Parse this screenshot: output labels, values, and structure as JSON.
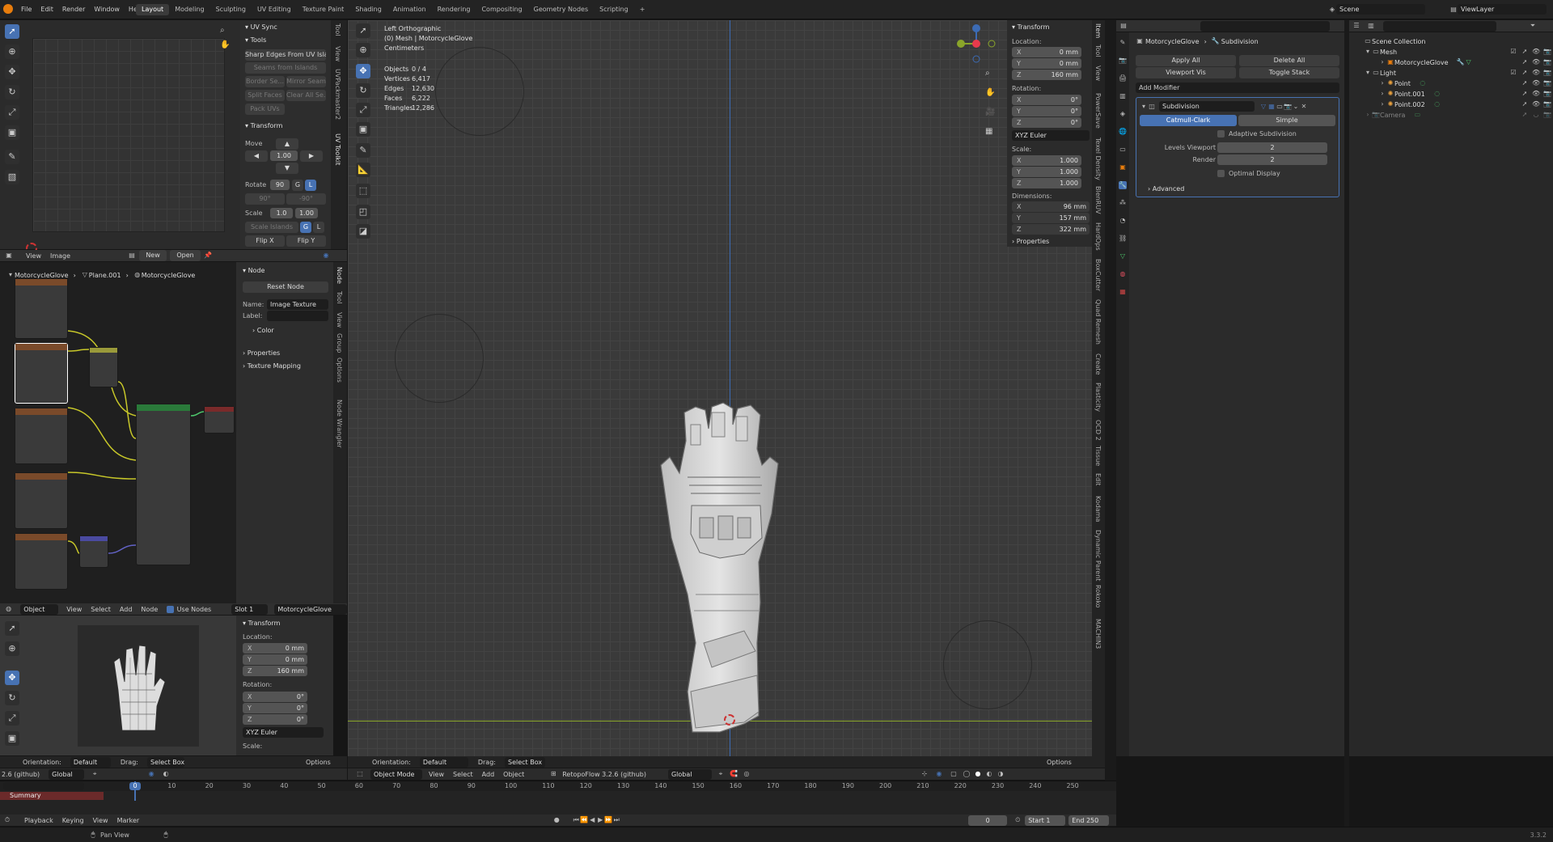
{
  "topbar": {
    "menus": [
      "File",
      "Edit",
      "Render",
      "Window",
      "Help"
    ],
    "workspaces": [
      "Layout",
      "Modeling",
      "Sculpting",
      "UV Editing",
      "Texture Paint",
      "Shading",
      "Animation",
      "Rendering",
      "Compositing",
      "Geometry Nodes",
      "Scripting"
    ],
    "add_tab": "+",
    "scene": "Scene",
    "view_layer": "ViewLayer"
  },
  "uv_panel": {
    "uv_sync": "UV Sync",
    "tools": "Tools",
    "sharp_edges": "Sharp Edges From UV Islands",
    "seams_from_islands": "Seams from Islands",
    "border_se": "Border Se...",
    "mirror_seam": "Mirror Seam",
    "split_faces": "Split Faces",
    "clear_all_se": "Clear All Se...",
    "pack_uvs": "Pack UVs",
    "transform": "Transform",
    "move": "Move",
    "move_value": "1.00",
    "rotate": "Rotate",
    "rotate_value": "90",
    "g": "G",
    "l": "L",
    "deg90a": "90°",
    "deg90b": "-90°",
    "scale": "Scale",
    "scale_a": "1.0",
    "scale_b": "1.00",
    "scale_islands": "Scale Islands",
    "flip_x": "Flip X",
    "flip_y": "Flip Y",
    "tabs": [
      "Tool",
      "View",
      "UVPackmaster2",
      "UV Toolkit"
    ]
  },
  "image_header": {
    "view": "View",
    "image": "Image",
    "new": "New",
    "open": "Open"
  },
  "node_editor": {
    "breadcrumb": [
      "MotorcycleGlove",
      "Plane.001",
      "MotorcycleGlove"
    ],
    "side_title": "Node",
    "reset_node": "Reset Node",
    "name_label": "Name:",
    "name_value": "Image Texture",
    "label_label": "Label:",
    "color": "Color",
    "properties": "Properties",
    "texture_mapping": "Texture Mapping",
    "tabs": [
      "Node",
      "Tool",
      "View",
      "Group",
      "Options",
      "Node Wrangler"
    ],
    "footer": {
      "object": "Object",
      "view": "View",
      "select": "Select",
      "add": "Add",
      "node": "Node",
      "use_nodes": "Use Nodes",
      "slot": "Slot 1",
      "material": "MotorcycleGlove"
    }
  },
  "preview_panel": {
    "transform": "Transform",
    "location": "Location:",
    "x": "X",
    "y": "Y",
    "z": "Z",
    "loc_x": "0 mm",
    "loc_y": "0 mm",
    "loc_z": "160 mm",
    "rotation": "Rotation:",
    "rot_x": "0°",
    "rot_y": "0°",
    "rot_z": "0°",
    "euler": "XYZ Euler",
    "scale": "Scale:"
  },
  "left_footer": {
    "orientation": "Orientation:",
    "default": "Default",
    "drag": "Drag:",
    "select_box": "Select Box",
    "options": "Options",
    "version": "2.6 (github)",
    "global": "Global"
  },
  "viewport": {
    "view_name": "Left Orthographic",
    "collection": "(0) Mesh | MotorcycleGlove",
    "units": "Centimeters",
    "stats": [
      {
        "label": "Objects",
        "value": "0 / 4"
      },
      {
        "label": "Vertices",
        "value": "6,417"
      },
      {
        "label": "Edges",
        "value": "12,630"
      },
      {
        "label": "Faces",
        "value": "6,222"
      },
      {
        "label": "Triangles",
        "value": "12,286"
      }
    ],
    "header": {
      "object_mode": "Object Mode",
      "view": "View",
      "select": "Select",
      "add": "Add",
      "object": "Object",
      "retopoflow": "RetopoFlow 3.2.6 (github)",
      "global": "Global"
    },
    "footer": {
      "orientation": "Orientation:",
      "default": "Default",
      "drag": "Drag:",
      "select_box": "Select Box",
      "options": "Options"
    },
    "tabs": [
      "Item",
      "Tool",
      "View",
      "PowerSave",
      "Texel Density",
      "BlenRUV",
      "HardOps",
      "BoxCutter",
      "Quad Remesh",
      "Create",
      "Plasticity",
      "OCD 2",
      "Tissue",
      "Edit",
      "Kodama",
      "Dynamic Parent",
      "Rokoko",
      "MACHIN3"
    ]
  },
  "n_panel": {
    "transform": "Transform",
    "location": "Location:",
    "loc": [
      "0 mm",
      "0 mm",
      "160 mm"
    ],
    "rotation": "Rotation:",
    "rot": [
      "0°",
      "0°",
      "0°"
    ],
    "euler": "XYZ Euler",
    "scale": "Scale:",
    "scl": [
      "1.000",
      "1.000",
      "1.000"
    ],
    "dimensions": "Dimensions:",
    "dim": [
      "96 mm",
      "157 mm",
      "322 mm"
    ],
    "axes": [
      "X",
      "Y",
      "Z"
    ],
    "properties": "Properties"
  },
  "properties": {
    "breadcrumb_obj": "MotorcycleGlove",
    "breadcrumb_mod": "Subdivision",
    "apply_all": "Apply All",
    "delete_all": "Delete All",
    "viewport_vis": "Viewport Vis",
    "toggle_stack": "Toggle Stack",
    "add_modifier": "Add Modifier",
    "modifier_name": "Subdivision",
    "catmull": "Catmull-Clark",
    "simple": "Simple",
    "adaptive": "Adaptive Subdivision",
    "levels_viewport": "Levels Viewport",
    "levels_viewport_value": "2",
    "render": "Render",
    "render_value": "2",
    "optimal_display": "Optimal Display",
    "advanced": "Advanced"
  },
  "outliner": {
    "root": "Scene Collection",
    "items": [
      {
        "name": "Mesh",
        "depth": 1
      },
      {
        "name": "MotorcycleGlove",
        "depth": 2
      },
      {
        "name": "Light",
        "depth": 1
      },
      {
        "name": "Point",
        "depth": 2
      },
      {
        "name": "Point.001",
        "depth": 2
      },
      {
        "name": "Point.002",
        "depth": 2
      },
      {
        "name": "Camera",
        "depth": 1
      }
    ]
  },
  "timeline": {
    "summary": "Summary",
    "ticks": [
      10,
      20,
      30,
      40,
      50,
      60,
      70,
      80,
      90,
      100,
      110,
      120,
      130,
      140,
      150,
      160,
      170,
      180,
      190,
      200,
      210,
      220,
      230,
      240,
      250
    ],
    "current": "0",
    "playback": "Playback",
    "keying": "Keying",
    "view": "View",
    "marker": "Marker",
    "frame": "0",
    "start": "Start",
    "start_val": "1",
    "end": "End",
    "end_val": "250"
  },
  "statusbar": {
    "pan_view": "Pan View",
    "version": "3.3.2"
  }
}
